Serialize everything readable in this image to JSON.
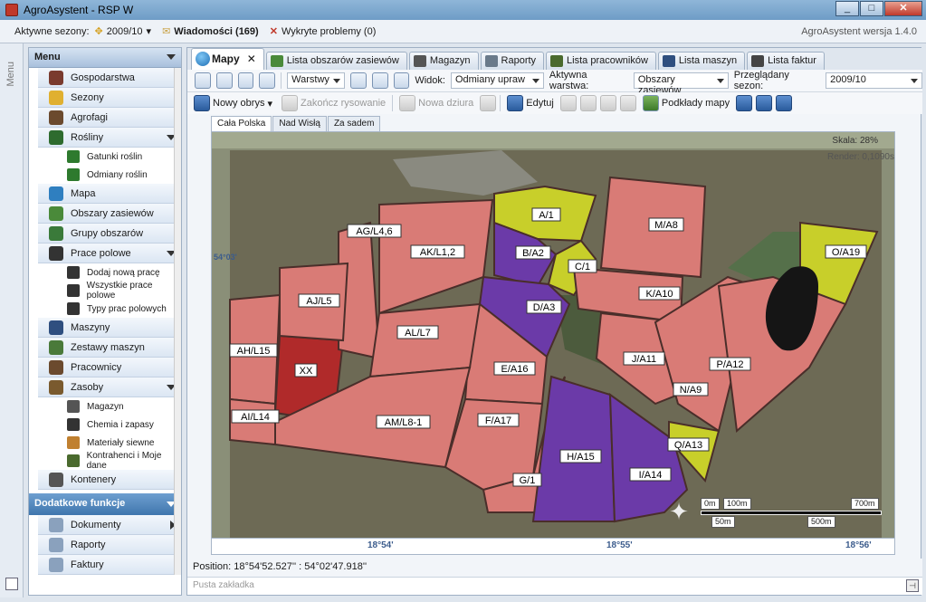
{
  "window": {
    "title": "AgroAsystent - RSP W"
  },
  "status": {
    "seasons_label": "Aktywne sezony:",
    "season_value": "2009/10",
    "messages": "Wiadomości (169)",
    "problems": "Wykryte problemy (0)",
    "version": "AgroAsystent wersja 1.4.0"
  },
  "menu_strip": {
    "label": "Menu"
  },
  "sidebar": {
    "title": "Menu",
    "items": [
      {
        "label": "Gospodarstwa",
        "icon": "farm-icon",
        "color": "#7a3b2e"
      },
      {
        "label": "Sezony",
        "icon": "season-icon",
        "color": "#e0b030"
      },
      {
        "label": "Agrofagi",
        "icon": "pest-icon",
        "color": "#6b4a2e"
      },
      {
        "label": "Rośliny",
        "icon": "plant-icon",
        "color": "#2e6b2e"
      },
      {
        "label": "Gatunki roślin",
        "icon": "leaf-icon",
        "color": "#2e7a2e"
      },
      {
        "label": "Odmiany roślin",
        "icon": "leaf-icon",
        "color": "#2e7a2e"
      },
      {
        "label": "Mapa",
        "icon": "globe-icon",
        "color": "#2f7fc0"
      },
      {
        "label": "Obszary zasiewów",
        "icon": "field-icon",
        "color": "#4a8a3a"
      },
      {
        "label": "Grupy obszarów",
        "icon": "group-icon",
        "color": "#3a7a3a"
      },
      {
        "label": "Prace polowe",
        "icon": "work-icon",
        "color": "#333"
      },
      {
        "label": "Dodaj nową pracę",
        "icon": "add-work-icon",
        "color": "#333"
      },
      {
        "label": "Wszystkie prace polowe",
        "icon": "work-icon",
        "color": "#333"
      },
      {
        "label": "Typy prac polowych",
        "icon": "work-icon",
        "color": "#333"
      },
      {
        "label": "Maszyny",
        "icon": "tractor-icon",
        "color": "#2f4f7f"
      },
      {
        "label": "Zestawy maszyn",
        "icon": "machine-set-icon",
        "color": "#4a7a3a"
      },
      {
        "label": "Pracownicy",
        "icon": "workers-icon",
        "color": "#6b4a2e"
      },
      {
        "label": "Zasoby",
        "icon": "resources-icon",
        "color": "#7a5a2e"
      },
      {
        "label": "Magazyn",
        "icon": "warehouse-icon",
        "color": "#555"
      },
      {
        "label": "Chemia i zapasy",
        "icon": "chemistry-icon",
        "color": "#333"
      },
      {
        "label": "Materiały siewne",
        "icon": "seed-icon",
        "color": "#c08030"
      },
      {
        "label": "Kontrahenci i Moje dane",
        "icon": "contacts-icon",
        "color": "#4a6a2e"
      },
      {
        "label": "Kontenery",
        "icon": "container-icon",
        "color": "#555"
      }
    ],
    "section2": "Dodatkowe funkcje",
    "section2_items": [
      {
        "label": "Dokumenty"
      },
      {
        "label": "Raporty"
      },
      {
        "label": "Faktury"
      }
    ]
  },
  "tabs": [
    "Mapy",
    "Lista obszarów zasiewów",
    "Magazyn",
    "Raporty",
    "Lista pracowników",
    "Lista maszyn",
    "Lista faktur"
  ],
  "toolbar1": {
    "layers": "Warstwy",
    "view_label": "Widok:",
    "view_value": "Odmiany upraw",
    "active_layer_label": "Aktywna warstwa:",
    "active_layer_value": "Obszary zasiewów",
    "season_label": "Przeglądany sezon:",
    "season_value": "2009/10"
  },
  "toolbar2": {
    "new_outline": "Nowy obrys",
    "finish_drawing": "Zakończ rysowanie",
    "new_hole": "Nowa dziura",
    "edit": "Edytuj",
    "base_maps": "Podkłady mapy"
  },
  "subtabs": [
    "Cała Polska",
    "Nad Wisłą",
    "Za sadem"
  ],
  "map": {
    "scale": "Skala: 28%",
    "render": "Render: 0,1090s",
    "lat_mark": "54°03'",
    "fields": [
      {
        "label": "A/1",
        "color": "#c8cf2a"
      },
      {
        "label": "B/A2",
        "color": "#6b3aa8"
      },
      {
        "label": "C/1",
        "color": "#c8cf2a"
      },
      {
        "label": "D/A3",
        "color": "#6b3aa8"
      },
      {
        "label": "E/A16",
        "color": "#d97b76"
      },
      {
        "label": "F/A17",
        "color": "#d97b76"
      },
      {
        "label": "G/1",
        "color": "#d97b76"
      },
      {
        "label": "H/A15",
        "color": "#6b3aa8"
      },
      {
        "label": "I/A14",
        "color": "#6b3aa8"
      },
      {
        "label": "J/A11",
        "color": "#d97b76"
      },
      {
        "label": "K/A10",
        "color": "#d97b76"
      },
      {
        "label": "M/A8",
        "color": "#d97b76"
      },
      {
        "label": "N/A9",
        "color": "#d97b76"
      },
      {
        "label": "O/A19",
        "color": "#c8cf2a"
      },
      {
        "label": "P/A12",
        "color": "#d97b76"
      },
      {
        "label": "Q/A13",
        "color": "#c8cf2a"
      },
      {
        "label": "XX",
        "color": "#b02a2a"
      },
      {
        "label": "AG/L4,6",
        "color": "#d97b76"
      },
      {
        "label": "AK/L1,2",
        "color": "#d97b76"
      },
      {
        "label": "AJ/L5",
        "color": "#d97b76"
      },
      {
        "label": "AL/L7",
        "color": "#d97b76"
      },
      {
        "label": "AH/L15",
        "color": "#d97b76"
      },
      {
        "label": "AI/L14",
        "color": "#d97b76"
      },
      {
        "label": "AM/L8-1",
        "color": "#d97b76"
      }
    ],
    "scalebar": [
      "0m",
      "100m",
      "700m",
      "50m",
      "500m"
    ],
    "coords": [
      "18°54'",
      "18°55'",
      "18°56'"
    ]
  },
  "position": "Position:  18°54'52.527'' : 54°02'47.918''",
  "bookmark_placeholder": "Pusta zakładka"
}
